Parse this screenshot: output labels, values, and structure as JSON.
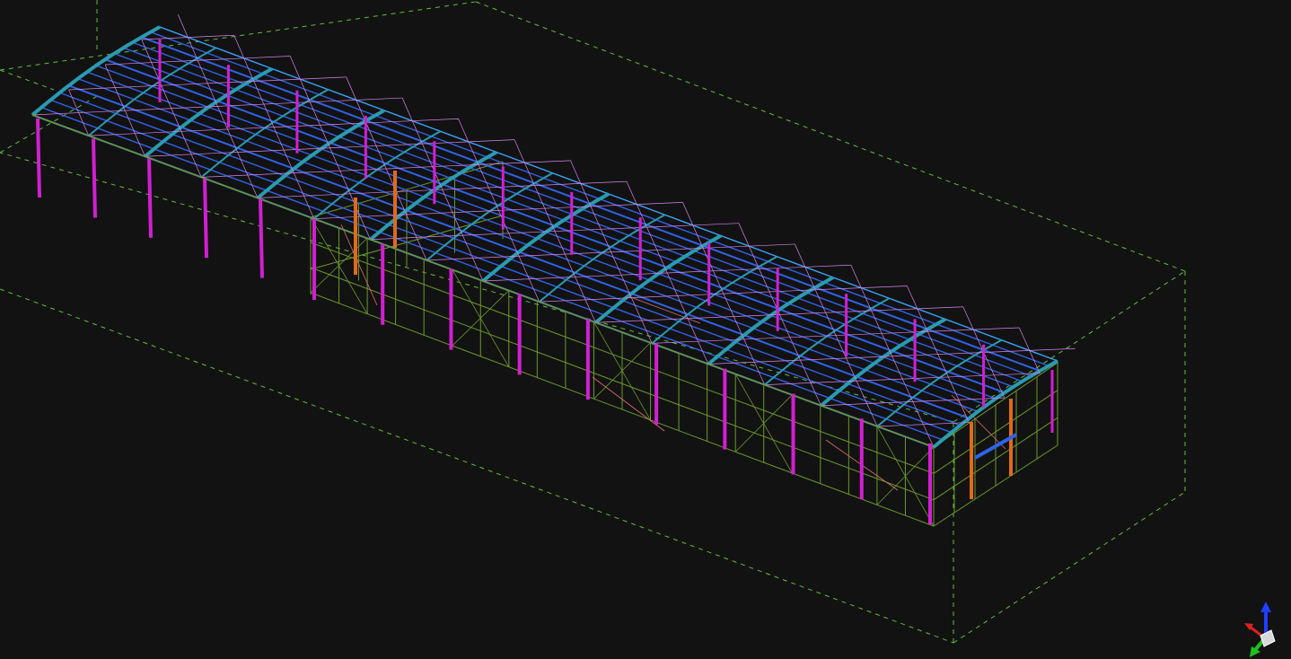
{
  "viewport": {
    "background": "#121212",
    "view_mode": "3D wireframe",
    "title": ""
  },
  "colors": {
    "bounding_box": "#5fbf3a",
    "wall_framing": "#6b9a2a",
    "roof_purlins": "#2f63e8",
    "roof_rafters": "#2a9bb0",
    "roof_top": "#3aa6ff",
    "roof_bracing": "#d884f0",
    "columns": "#d21fd2",
    "gable_columns": "#e06a1a",
    "bracing": "#e07070",
    "axis_x": "#e02020",
    "axis_y": "#20c020",
    "axis_z": "#2040ff"
  },
  "model": {
    "type": "steel-frame-building",
    "frames_left_section": 5,
    "frames_main_section": 11,
    "purlins_per_frame": 14,
    "columns_left_section": 5,
    "columns_front_main": 9
  },
  "axis_triad": {
    "axes": [
      "x",
      "y",
      "z"
    ],
    "icons": [
      "axis-x-icon",
      "axis-y-icon",
      "axis-z-icon"
    ]
  }
}
